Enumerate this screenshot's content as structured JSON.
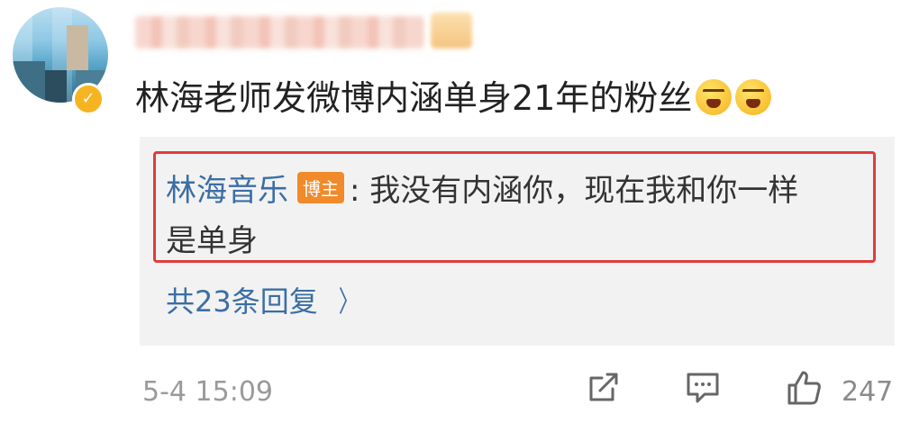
{
  "comment": {
    "text": "林海老师发微博内涵单身21年的粉丝"
  },
  "reply": {
    "author": "林海音乐",
    "tag": "博主",
    "line1": ": 我没有内涵你，现在我和你一样",
    "line2": "是单身"
  },
  "more_replies": {
    "label": "共23条回复",
    "chevron": "〉"
  },
  "footer": {
    "timestamp": "5-4 15:09",
    "like_count": "247"
  },
  "icons": {
    "share": "share-icon",
    "comment": "comment-icon",
    "like": "thumbs-up-icon",
    "verified": "verified-badge-icon",
    "emoji": "angry-face-emoji"
  },
  "colors": {
    "link_blue": "#3b6ea5",
    "highlight_red": "#e23b3b",
    "tag_orange": "#f08a2a",
    "reply_bg": "#f2f2f2"
  }
}
